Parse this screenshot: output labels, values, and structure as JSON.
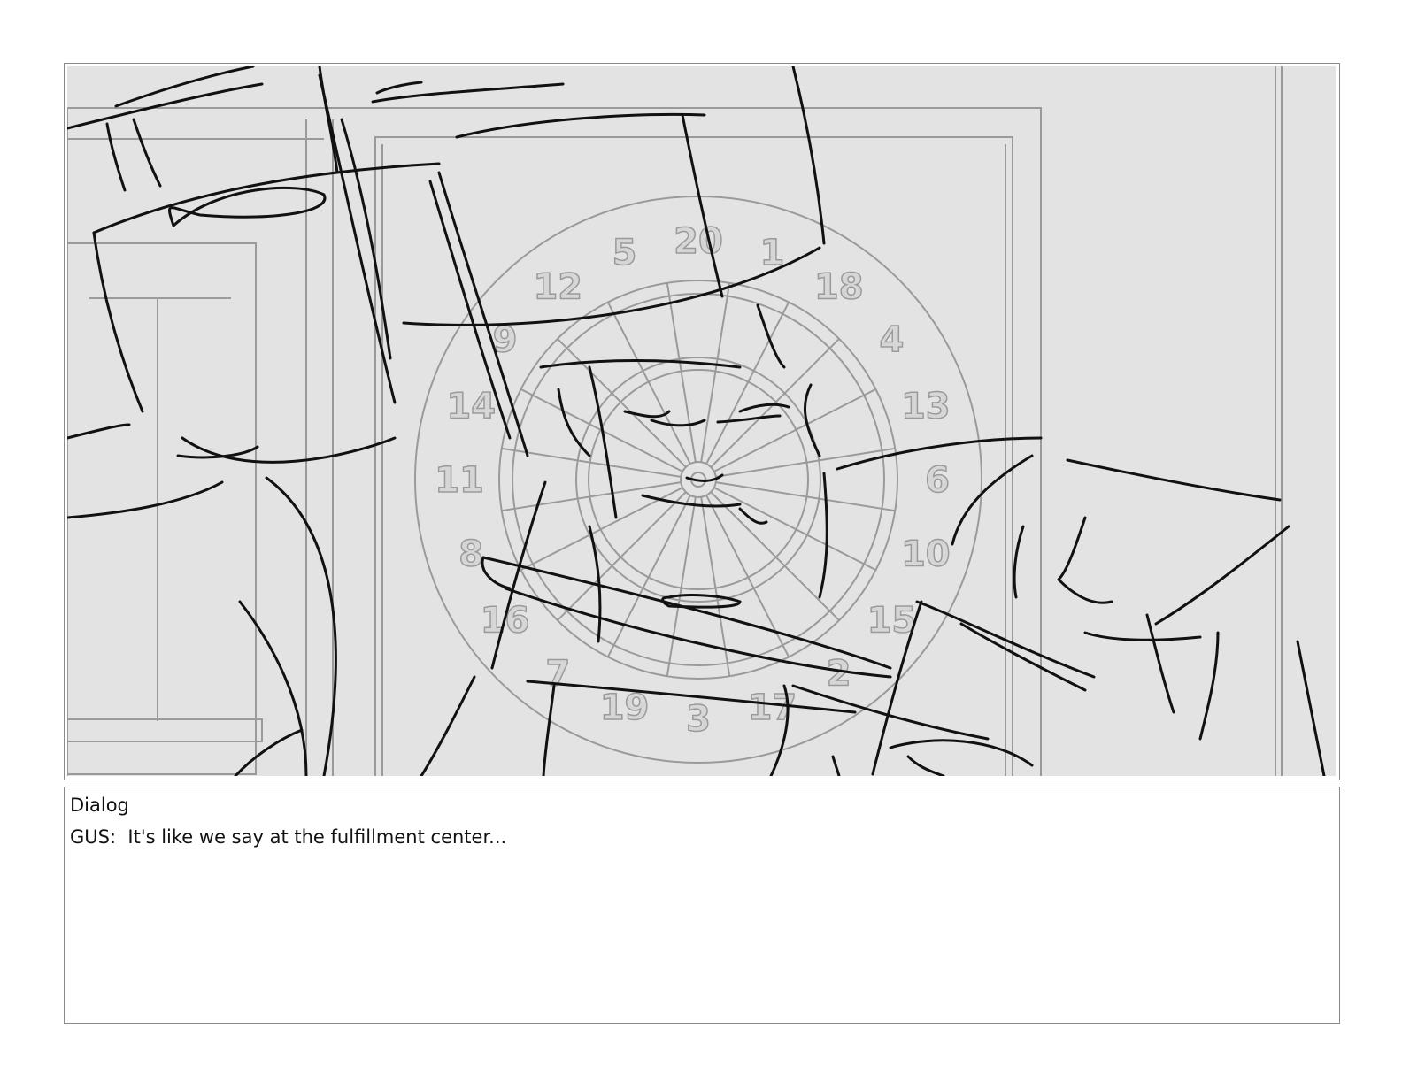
{
  "dartboard": {
    "numbers": [
      "20",
      "1",
      "18",
      "4",
      "13",
      "6",
      "10",
      "15",
      "2",
      "17",
      "3",
      "19",
      "7",
      "16",
      "8",
      "11",
      "14",
      "9",
      "12",
      "5"
    ]
  },
  "dialog": {
    "heading": "Dialog",
    "line": "GUS:  It's like we say at the fulfillment center..."
  },
  "colors": {
    "panel_background": "#e3e3e3",
    "sketch_line": "#111111",
    "dartboard_line": "#9a9a9a",
    "frame_border": "#8a8a8a"
  }
}
